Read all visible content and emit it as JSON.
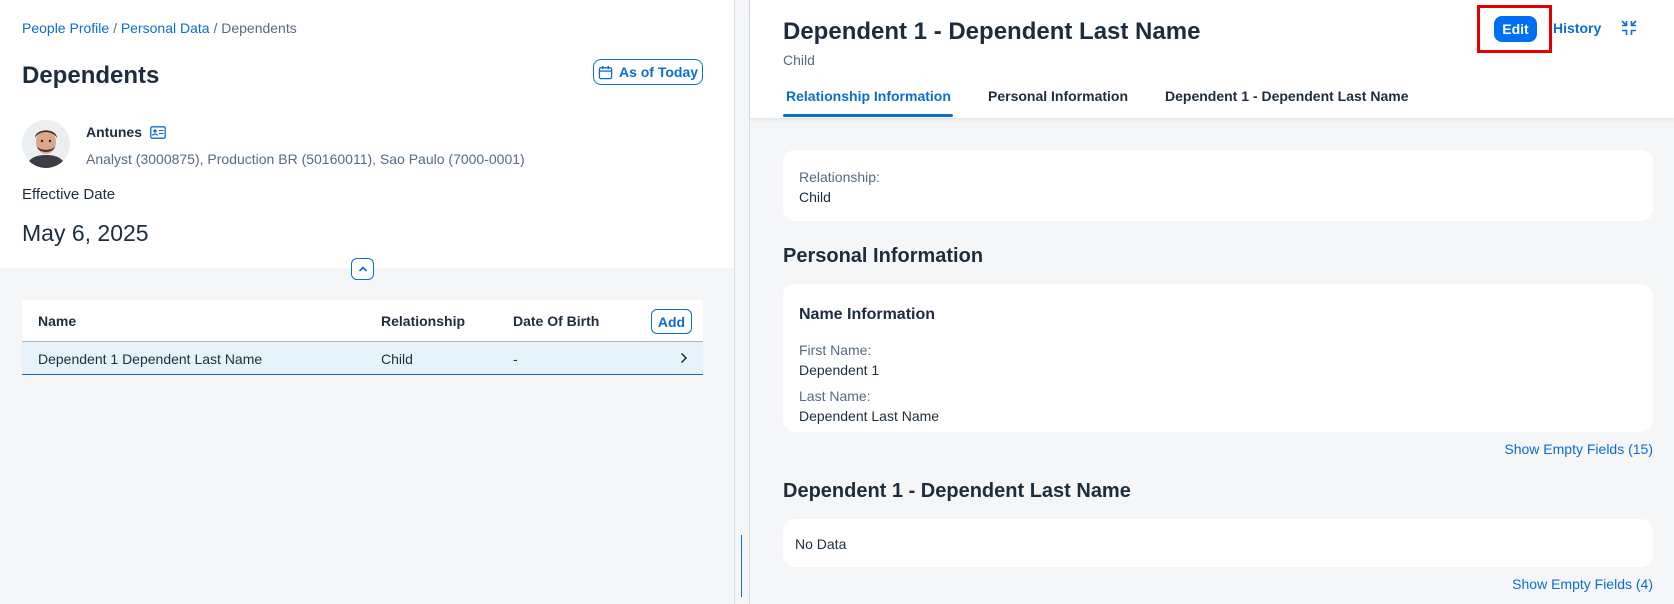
{
  "breadcrumb": {
    "items": [
      "People Profile",
      "Personal Data"
    ],
    "current": "Dependents",
    "separator": "/"
  },
  "left": {
    "title": "Dependents",
    "as_of_label": "As of Today",
    "employee": {
      "name": "Antunes",
      "detail": "Analyst (3000875), Production BR (50160011), Sao Paulo (7000-0001)"
    },
    "effective_date_label": "Effective Date",
    "effective_date": "May 6, 2025",
    "table": {
      "columns": [
        "Name",
        "Relationship",
        "Date Of Birth"
      ],
      "add_label": "Add",
      "rows": [
        {
          "name": "Dependent 1 Dependent Last Name",
          "relationship": "Child",
          "dob": "-"
        }
      ]
    }
  },
  "right": {
    "title": "Dependent 1 - Dependent Last Name",
    "subtitle": "Child",
    "edit_label": "Edit",
    "history_label": "History",
    "tabs": [
      {
        "label": "Relationship Information"
      },
      {
        "label": "Personal Information"
      },
      {
        "label": "Dependent 1 - Dependent Last Name"
      }
    ],
    "relationship_card": {
      "label": "Relationship:",
      "value": "Child"
    },
    "personal_section": {
      "title": "Personal Information",
      "group_title": "Name Information",
      "fields": [
        {
          "label": "First Name:",
          "value": "Dependent 1"
        },
        {
          "label": "Last Name:",
          "value": "Dependent Last Name"
        }
      ],
      "show_empty": "Show Empty Fields (15)"
    },
    "dependent_section": {
      "title": "Dependent 1 - Dependent Last Name",
      "no_data": "No Data",
      "show_empty": "Show Empty Fields (4)"
    }
  },
  "colors": {
    "accent": "#0a6ed1",
    "edit_button": "#0070f2",
    "highlight_frame": "#e30000",
    "row_selected": "#e6f3fb"
  },
  "icons": {
    "calendar": "calendar-icon",
    "business_card": "business-card-icon",
    "collapse": "chevron-up-icon",
    "row_nav": "chevron-right-icon",
    "exit_fullscreen": "exit-fullscreen-icon"
  }
}
